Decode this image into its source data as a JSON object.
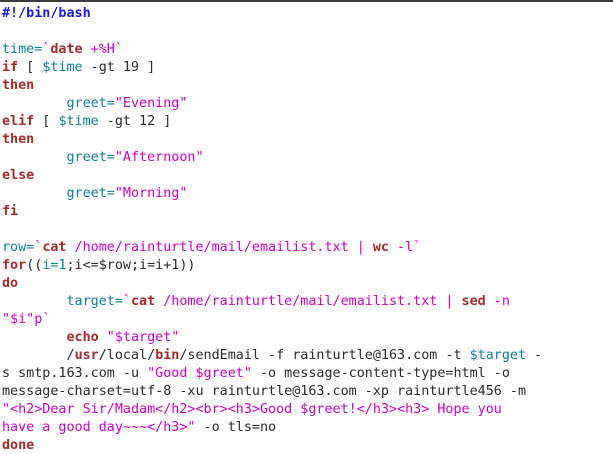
{
  "editor": {
    "lines": [
      [
        {
          "t": "#!/bin/bash",
          "c": "comment"
        }
      ],
      [],
      [
        {
          "t": "time=",
          "c": "var"
        },
        {
          "t": "`",
          "c": "str"
        },
        {
          "t": "date",
          "c": "kw"
        },
        {
          "t": " +%H",
          "c": "str"
        },
        {
          "t": "`",
          "c": "str"
        }
      ],
      [
        {
          "t": "if",
          "c": "kw"
        },
        {
          "t": " [ ",
          "c": "text"
        },
        {
          "t": "$time",
          "c": "var"
        },
        {
          "t": " -gt 19 ]",
          "c": "text"
        }
      ],
      [
        {
          "t": "then",
          "c": "kw"
        }
      ],
      [
        {
          "t": "        ",
          "c": "text"
        },
        {
          "t": "greet=",
          "c": "var"
        },
        {
          "t": "\"Evening\"",
          "c": "str"
        }
      ],
      [
        {
          "t": "elif",
          "c": "kw"
        },
        {
          "t": " [ ",
          "c": "text"
        },
        {
          "t": "$time",
          "c": "var"
        },
        {
          "t": " -gt 12 ]",
          "c": "text"
        }
      ],
      [
        {
          "t": "then",
          "c": "kw"
        }
      ],
      [
        {
          "t": "        ",
          "c": "text"
        },
        {
          "t": "greet=",
          "c": "var"
        },
        {
          "t": "\"Afternoon\"",
          "c": "str"
        }
      ],
      [
        {
          "t": "else",
          "c": "kw"
        }
      ],
      [
        {
          "t": "        ",
          "c": "text"
        },
        {
          "t": "greet=",
          "c": "var"
        },
        {
          "t": "\"Morning\"",
          "c": "str"
        }
      ],
      [
        {
          "t": "fi",
          "c": "kw"
        }
      ],
      [],
      [
        {
          "t": "row=",
          "c": "var"
        },
        {
          "t": "`",
          "c": "str"
        },
        {
          "t": "cat",
          "c": "kw"
        },
        {
          "t": " /home/rainturtle/mail/emailist.txt | ",
          "c": "str"
        },
        {
          "t": "wc",
          "c": "kw"
        },
        {
          "t": " -l",
          "c": "str"
        },
        {
          "t": "`",
          "c": "str"
        }
      ],
      [
        {
          "t": "for",
          "c": "kw"
        },
        {
          "t": "((",
          "c": "text"
        },
        {
          "t": "i=1",
          "c": "var"
        },
        {
          "t": ";i<=$row;i=i+1))",
          "c": "text"
        }
      ],
      [
        {
          "t": "do",
          "c": "kw"
        }
      ],
      [
        {
          "t": "        ",
          "c": "text"
        },
        {
          "t": "target=",
          "c": "var"
        },
        {
          "t": "`",
          "c": "str"
        },
        {
          "t": "cat",
          "c": "kw"
        },
        {
          "t": " /home/rainturtle/mail/emailist.txt | ",
          "c": "str"
        },
        {
          "t": "sed",
          "c": "kw"
        },
        {
          "t": " -n",
          "c": "str"
        }
      ],
      [
        {
          "t": "\"$i\"p",
          "c": "str"
        },
        {
          "t": "`",
          "c": "str"
        }
      ],
      [
        {
          "t": "        ",
          "c": "text"
        },
        {
          "t": "echo",
          "c": "kw"
        },
        {
          "t": " \"$target\"",
          "c": "str"
        }
      ],
      [
        {
          "t": "        ",
          "c": "text"
        },
        {
          "t": "/",
          "c": "text"
        },
        {
          "t": "usr",
          "c": "kw"
        },
        {
          "t": "/local/",
          "c": "text"
        },
        {
          "t": "bin",
          "c": "kw"
        },
        {
          "t": "/sendEmail -f rainturtle@163.com -t ",
          "c": "text"
        },
        {
          "t": "$target",
          "c": "var"
        },
        {
          "t": " -",
          "c": "text"
        }
      ],
      [
        {
          "t": "s smtp.163.com -u ",
          "c": "text"
        },
        {
          "t": "\"Good $greet\"",
          "c": "str"
        },
        {
          "t": " -o message-content-type=html -o",
          "c": "text"
        }
      ],
      [
        {
          "t": "message-charset=utf-8 -xu rainturtle@163.com -xp rainturtle456 -m",
          "c": "text"
        }
      ],
      [
        {
          "t": "\"<h2>Dear Sir/Madam</h2><br><h3>Good $greet!</h3><h3> Hope you",
          "c": "str"
        }
      ],
      [
        {
          "t": "have a good day~~~</h3>\"",
          "c": "str"
        },
        {
          "t": " -o tls=no",
          "c": "text"
        }
      ],
      [
        {
          "t": "done",
          "c": "kw"
        }
      ]
    ]
  },
  "colors": {
    "background": "#ffffff",
    "top_rule": "#3c3b37",
    "text": "#2a2a2a",
    "keyword": "#a52a2a",
    "comment": "#1a1adc",
    "variable": "#0e7e9e",
    "string": "#cc00cc"
  }
}
